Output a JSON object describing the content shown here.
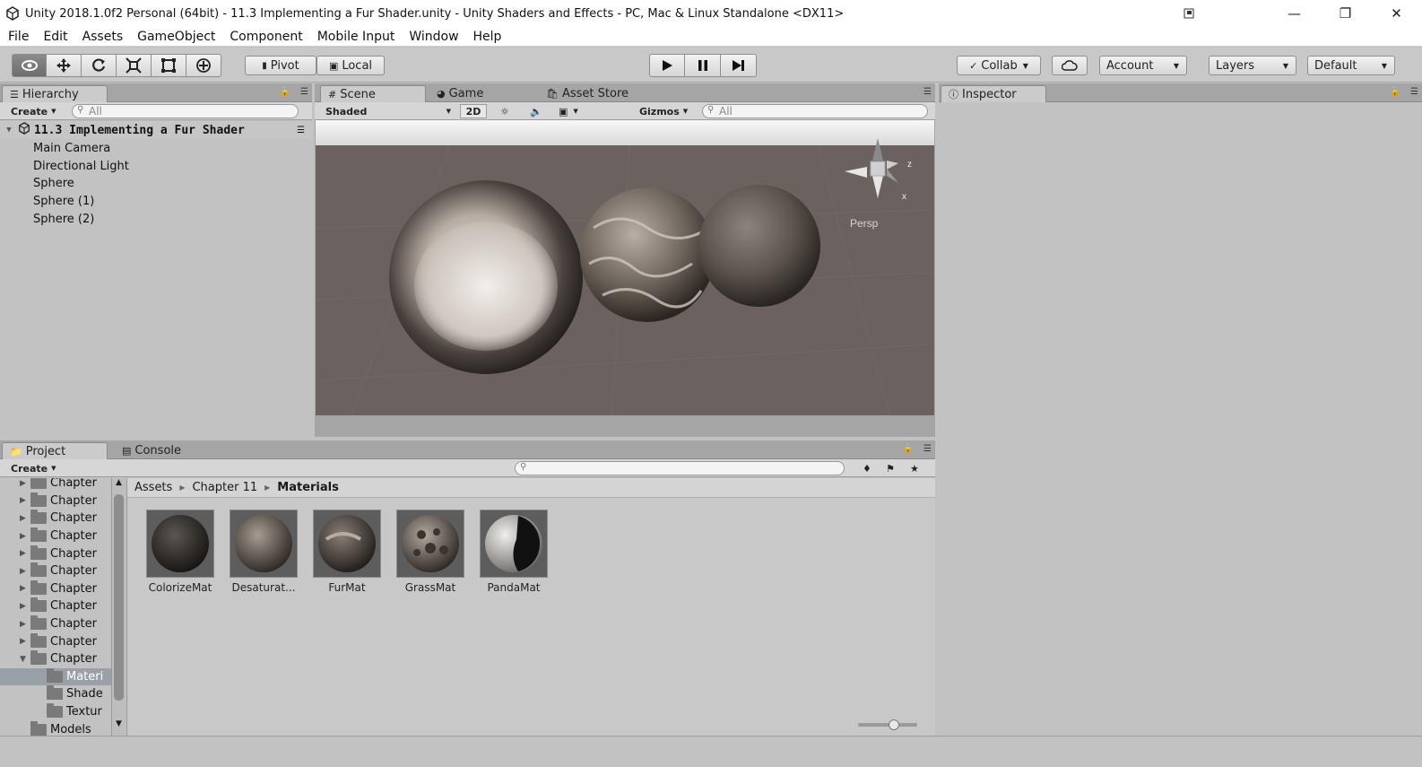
{
  "window": {
    "title": "Unity 2018.1.0f2 Personal (64bit) - 11.3 Implementing a Fur Shader.unity - Unity Shaders and Effects - PC, Mac & Linux Standalone <DX11>"
  },
  "menu": [
    "File",
    "Edit",
    "Assets",
    "GameObject",
    "Component",
    "Mobile Input",
    "Window",
    "Help"
  ],
  "toolbar": {
    "pivot": "Pivot",
    "local": "Local",
    "collab": "Collab",
    "account": "Account",
    "layers": "Layers",
    "layout": "Default"
  },
  "hierarchy": {
    "tab": "Hierarchy",
    "create": "Create",
    "search_placeholder": "All",
    "scene": "11.3 Implementing a Fur Shader",
    "items": [
      "Main Camera",
      "Directional Light",
      "Sphere",
      "Sphere (1)",
      "Sphere (2)"
    ]
  },
  "scene": {
    "tabs": [
      "Scene",
      "Game",
      "Asset Store"
    ],
    "shading": "Shaded",
    "mode2d": "2D",
    "gizmos": "Gizmos",
    "search_placeholder": "All",
    "persp": "Persp",
    "axis_z": "z",
    "axis_x": "x"
  },
  "inspector": {
    "tab": "Inspector"
  },
  "project": {
    "tabs": [
      "Project",
      "Console"
    ],
    "create": "Create",
    "breadcrumb": [
      "Assets",
      "Chapter 11",
      "Materials"
    ],
    "tree": [
      {
        "label": "Chapter",
        "indent": 0,
        "arrow": "right"
      },
      {
        "label": "Chapter",
        "indent": 0,
        "arrow": "right"
      },
      {
        "label": "Chapter",
        "indent": 0,
        "arrow": "right"
      },
      {
        "label": "Chapter",
        "indent": 0,
        "arrow": "right"
      },
      {
        "label": "Chapter",
        "indent": 0,
        "arrow": "right"
      },
      {
        "label": "Chapter",
        "indent": 0,
        "arrow": "right"
      },
      {
        "label": "Chapter",
        "indent": 0,
        "arrow": "right"
      },
      {
        "label": "Chapter",
        "indent": 0,
        "arrow": "right"
      },
      {
        "label": "Chapter",
        "indent": 0,
        "arrow": "right"
      },
      {
        "label": "Chapter",
        "indent": 0,
        "arrow": "right"
      },
      {
        "label": "Chapter",
        "indent": 0,
        "arrow": "down"
      },
      {
        "label": "Materi",
        "indent": 1,
        "arrow": "",
        "selected": true
      },
      {
        "label": "Shade",
        "indent": 1,
        "arrow": ""
      },
      {
        "label": "Textur",
        "indent": 1,
        "arrow": ""
      },
      {
        "label": "Models",
        "indent": 0,
        "arrow": ""
      }
    ],
    "assets": [
      "ColorizeMat",
      "Desaturat...",
      "FurMat",
      "GrassMat",
      "PandaMat"
    ]
  }
}
